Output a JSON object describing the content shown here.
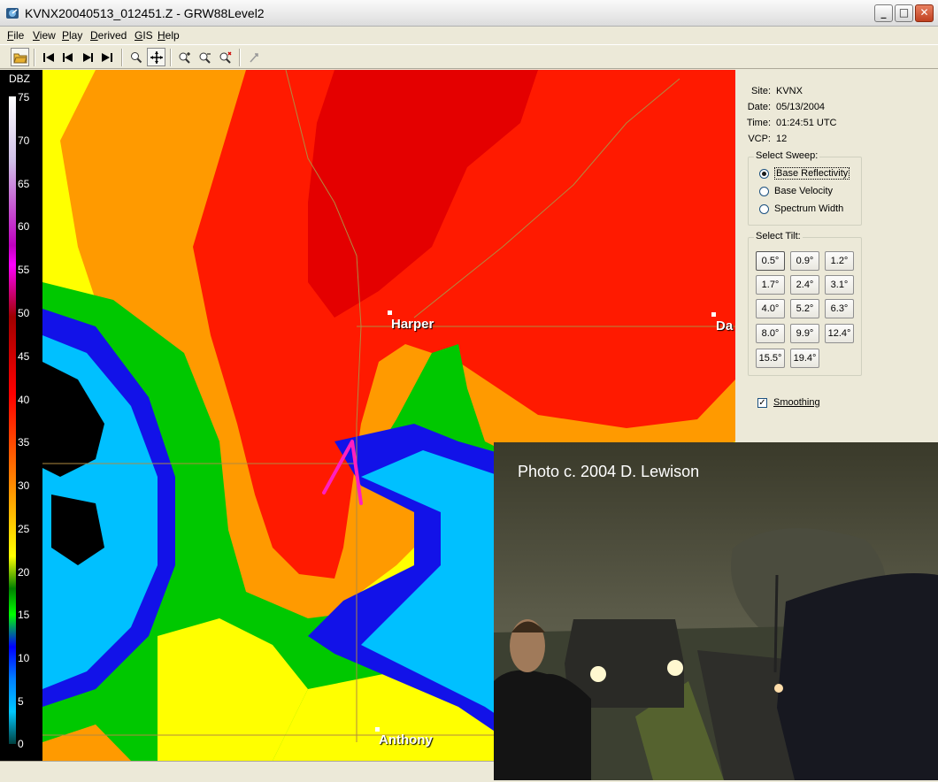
{
  "window": {
    "title": "KVNX20040513_012451.Z - GRW88Level2",
    "controls": {
      "minimize": "_",
      "maximize": "□",
      "close": "✕"
    }
  },
  "menu": [
    "File",
    "View",
    "Play",
    "Derived",
    "GIS",
    "Help"
  ],
  "toolbar_icons": [
    "open-folder-icon",
    "first-frame-icon",
    "previous-frame-icon",
    "next-frame-icon",
    "last-frame-icon",
    "zoom-icon",
    "pan-icon",
    "zoom-in-icon",
    "zoom-out-icon",
    "zoom-reset-icon",
    "pointer-icon"
  ],
  "legend": {
    "title": "DBZ",
    "ticks": [
      "75",
      "70",
      "65",
      "60",
      "55",
      "50",
      "45",
      "40",
      "35",
      "30",
      "25",
      "20",
      "15",
      "10",
      "5",
      "0"
    ]
  },
  "map": {
    "cities": [
      {
        "name": "Harper"
      },
      {
        "name": "Da"
      },
      {
        "name": "Anthony"
      }
    ],
    "colors": {
      "black": "#000000",
      "dark_blue": "#1010e0",
      "blue": "#0090ff",
      "cyan": "#00d0ff",
      "green": "#00c000",
      "yellow": "#ffff00",
      "orange": "#ff9000",
      "red": "#ff0000",
      "dark_red": "#e00000",
      "hook_marker": "#ff20c0",
      "county_lines": "#b08a40"
    }
  },
  "info": {
    "site_label": "Site:",
    "site": "KVNX",
    "date_label": "Date:",
    "date": "05/13/2004",
    "time_label": "Time:",
    "time": "01:24:51 UTC",
    "vcp_label": "VCP:",
    "vcp": "12"
  },
  "sweep": {
    "label": "Select Sweep:",
    "options": [
      {
        "label": "Base Reflectivity",
        "selected": true
      },
      {
        "label": "Base Velocity",
        "selected": false
      },
      {
        "label": "Spectrum Width",
        "selected": false
      }
    ]
  },
  "tilt": {
    "label": "Select Tilt:",
    "options": [
      "0.5°",
      "0.9°",
      "1.2°",
      "1.7°",
      "2.4°",
      "3.1°",
      "4.0°",
      "5.2°",
      "6.3°",
      "8.0°",
      "9.9°",
      "12.4°",
      "15.5°",
      "19.4°"
    ],
    "selected": "0.5°"
  },
  "smoothing": {
    "label": "Smoothing",
    "checked": true,
    "mark": "✓"
  },
  "photo": {
    "caption": "Photo c. 2004 D. Lewison"
  }
}
